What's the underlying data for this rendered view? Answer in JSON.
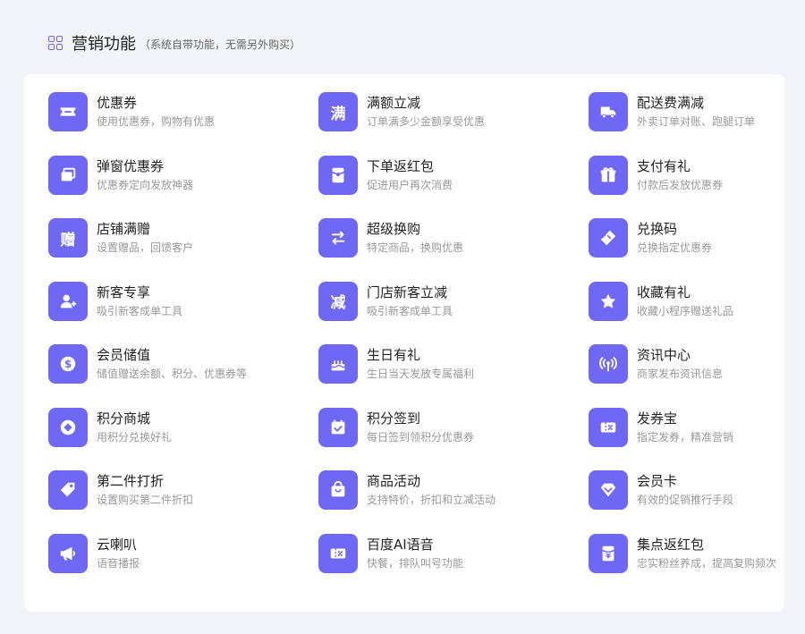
{
  "header": {
    "title": "营销功能",
    "subtitle": "（系统自带功能，无需另外购买）"
  },
  "items": [
    {
      "title": "优惠券",
      "desc": "使用优惠券，购物有优惠",
      "icon": "coupon-icon"
    },
    {
      "title": "满额立减",
      "desc": "订单满多少金额享受优惠",
      "icon": "full-reduction-icon",
      "glyph": "满"
    },
    {
      "title": "配送费满减",
      "desc": "外卖订单对账、跑腿订单",
      "icon": "delivery-truck-icon"
    },
    {
      "title": "弹窗优惠券",
      "desc": "优惠券定向发放神器",
      "icon": "popup-window-icon"
    },
    {
      "title": "下单返红包",
      "desc": "促进用户再次消费",
      "icon": "red-packet-icon"
    },
    {
      "title": "支付有礼",
      "desc": "付款后发放优惠券",
      "icon": "gift-box-icon"
    },
    {
      "title": "店铺满赠",
      "desc": "设置赠品，回馈客户",
      "icon": "store-gift-icon",
      "glyph": "赠"
    },
    {
      "title": "超级换购",
      "desc": "特定商品，换购优惠",
      "icon": "exchange-arrows-icon"
    },
    {
      "title": "兑换码",
      "desc": "兑换指定优惠券",
      "icon": "ticket-icon"
    },
    {
      "title": "新客专享",
      "desc": "吸引新客成单工具",
      "icon": "add-user-icon"
    },
    {
      "title": "门店新客立减",
      "desc": "吸引新客成单工具",
      "icon": "reduce-icon",
      "glyph": "减"
    },
    {
      "title": "收藏有礼",
      "desc": "收藏小程序赠送礼品",
      "icon": "star-icon"
    },
    {
      "title": "会员储值",
      "desc": "储值赠送余额、积分、优惠券等",
      "icon": "dollar-coin-icon"
    },
    {
      "title": "生日有礼",
      "desc": "生日当天发放专属福利",
      "icon": "birthday-cake-icon"
    },
    {
      "title": "资讯中心",
      "desc": "商家发布资讯信息",
      "icon": "broadcast-antenna-icon"
    },
    {
      "title": "积分商城",
      "desc": "用积分兑换好礼",
      "icon": "points-diamond-icon"
    },
    {
      "title": "积分签到",
      "desc": "每日签到领积分优惠券",
      "icon": "calendar-check-icon"
    },
    {
      "title": "发券宝",
      "desc": "指定发券，精准营销",
      "icon": "coupon-treasure-icon"
    },
    {
      "title": "第二件打折",
      "desc": "设置购买第二件折扣",
      "icon": "price-tag-icon"
    },
    {
      "title": "商品活动",
      "desc": "支持特价，折扣和立减活动",
      "icon": "shopping-bag-icon"
    },
    {
      "title": "会员卡",
      "desc": "有效的促销推行手段",
      "icon": "vip-diamond-icon"
    },
    {
      "title": "云喇叭",
      "desc": "语音播报",
      "icon": "megaphone-icon"
    },
    {
      "title": "百度AI语音",
      "desc": "快餐，排队叫号功能",
      "icon": "ai-voice-icon"
    },
    {
      "title": "集点返红包",
      "desc": "忠实粉丝养成，提高复购频次",
      "icon": "yen-packet-icon"
    }
  ]
}
